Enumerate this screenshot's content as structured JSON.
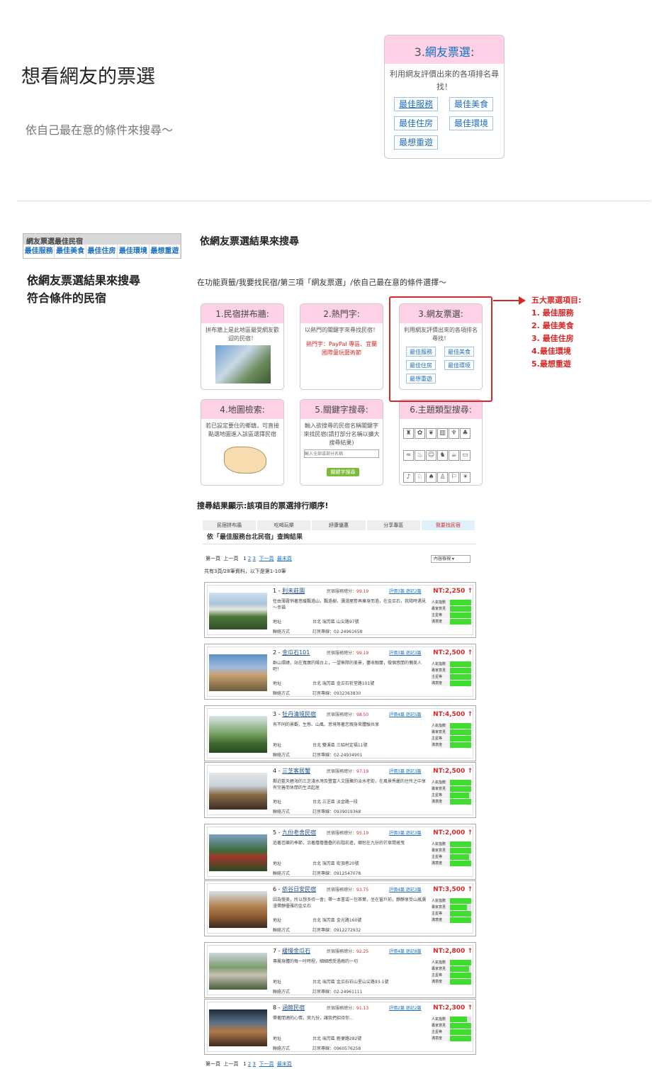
{
  "hero": {
    "title": "想看網友的票選",
    "subtitle": "依自己最在意的條件來搜尋～"
  },
  "big_card": {
    "num": "3.",
    "name": "網友票選",
    "colon": ":",
    "desc": "利用網友評價出來的各項排名尋找！",
    "buttons": [
      "最佳服務",
      "最佳美食",
      "最佳住房",
      "最佳環境",
      "最想重遊"
    ]
  },
  "mini_widget": {
    "title": "網友票選最佳民宿",
    "tabs": [
      "最佳服務",
      "最佳美食",
      "最佳住房",
      "最佳環境",
      "最想重遊"
    ]
  },
  "left_desc": {
    "line1": "依網友票選結果來搜尋",
    "line2": "符合條件的民宿"
  },
  "right_heading": "依網友票選結果來搜尋",
  "path_text": "在功能頁籤/我要找民宿/第三項「網友票選」/依自己最在意的條件選擇～",
  "search_cards": [
    {
      "head": "1.民宿拼布牆:",
      "desc": "拼布牆上是此地區最受網友歡迎的民宿！"
    },
    {
      "head": "2.熱門字:",
      "desc": "以熱門的關鍵字來尋找民宿！",
      "hot": "熱門字：PayPal 專區、宜蘭國際童玩藝術節"
    },
    {
      "head": "3.網友票選:",
      "desc": "利用網友評價出來的各項排名尋找！",
      "buttons": [
        "最佳服務",
        "最佳美食",
        "最佳住房",
        "最佳環境",
        "最想重遊"
      ]
    },
    {
      "head": "4.地圖檢索:",
      "desc": "若已設定要住的鄉鎮，可直接點選地圖進入該區選擇民宿"
    },
    {
      "head": "5.關鍵字搜尋:",
      "desc": "輸入欲搜尋的民宿名稱關鍵字來找民宿(請打部分名稱以擴大搜尋結果)",
      "placeholder": "輸入全部或部分名稱",
      "button": "關鍵字搜尋"
    },
    {
      "head": "6.主題類型搜尋:",
      "desc": ""
    }
  ],
  "red_list": {
    "title": "五大票選項目:",
    "items": [
      "1. 最佳服務",
      "2. 最佳美食",
      "3. 最佳住房",
      "4.最佳環境",
      "5.最想重遊"
    ]
  },
  "result_caption": "搜尋結果顯示:該項目的票選排行順序!",
  "results": {
    "tabs": [
      "民宿拼布牆",
      "吃喝玩樂",
      "紓康優惠",
      "分享專區",
      "我要找民宿"
    ],
    "header": "依「最佳服務台北民宿」查詢結果",
    "pager": {
      "first": "第一頁",
      "prev": "上一頁",
      "pages": [
        "1",
        "2",
        "3"
      ],
      "next": "下一頁",
      "last": "最末頁"
    },
    "sort": "內容檢視",
    "count": "共有3頁/28筆資料，以下是第1-10筆",
    "addr_label": "地址",
    "tel_label": "聯絡方式",
    "score_label": "民宿服務總分：",
    "meter_labels": [
      "人氣指數",
      "專家意見",
      "主星等",
      "滿意度"
    ],
    "items": [
      {
        "rank": "1 -",
        "name": "利未莊園",
        "score": "99.19",
        "links": "評價3篇 遊記2篇",
        "price": "NT:2,250 ↑",
        "desc": "任由薄霧悄著悠緩飄過山，飄過樹，瀰漫屋簷再擁身而過，在金瓜石，我隨時遇見～幸福",
        "addr": "台北 瑞芳區 山尖路97號",
        "tel": "訂房專線：02-24961658",
        "meters": [
          1,
          1,
          1,
          1
        ]
      },
      {
        "rank": "2 -",
        "name": "金瓜石101",
        "score": "99.19",
        "links": "評價3篇 遊記3篇",
        "price": "NT:2,500 ↑",
        "desc": "群山環繞，站在寬廣的陽台上，一望無際的美景，盡收眼簾，做個悠閒的懶美人吧！",
        "addr": "台北 瑞芳區 金瓜石祈堂路101號",
        "tel": "訂房專線：0932363830",
        "meters": [
          1,
          1,
          1,
          1
        ]
      },
      {
        "rank": "3 -",
        "name": "牡丹清境民宿",
        "score": "98.50",
        "links": "評價4篇 遊記5篇",
        "price": "NT:4,500 ↑",
        "desc": "有不同的景觀，生態、山風、意境等著您親身來體驗共享",
        "addr": "台北 雙溪區 三貂村定福11號",
        "tel": "訂房專線：02-24934901",
        "meters": [
          1,
          1,
          1,
          1
        ]
      },
      {
        "rank": "4 -",
        "name": "三芝客居蟹",
        "score": "97.19",
        "links": "評價3篇 遊記3篇",
        "price": "NT:2,500 ↑",
        "desc": "鄰近藍天碧海的三芝淺水灣及豐富人文匯聚的淡水老街，在風景秀麗的住所之中享有完善而休閒的生活起居",
        "addr": "台北 三芝區 淡金路一段",
        "tel": "訂房專線：0939019368",
        "meters": [
          1,
          1,
          0.9,
          1
        ]
      },
      {
        "rank": "5 -",
        "name": "九份老舍民宿",
        "score": "95.19",
        "links": "評價3篇 遊記3篇",
        "price": "NT:2,000 ↑",
        "desc": "追著芭樂的季節，沿著層層疊疊的石階前進，鄉愁在九份的芒草間搖曳",
        "addr": "台北 瑞芳區 街頂巷20號",
        "tel": "訂房專線：0912547078",
        "meters": [
          1,
          1,
          0.9,
          1
        ]
      },
      {
        "rank": "6 -",
        "name": "依谷日安民宿",
        "score": "93.75",
        "links": "評價4篇 遊記3篇",
        "price": "NT:3,500 ↑",
        "desc": "因為慢美，所以想多待一會；帶一本書或一包茶葉，坐在窗戶前，靜靜享受山嵐瀰漫帶靜優雅的金瓜石",
        "addr": "台北 瑞芳區 金光路160號",
        "tel": "訂房專線：0912272932",
        "meters": [
          1,
          0.8,
          1,
          1
        ]
      },
      {
        "rank": "7 -",
        "name": "緩慢金瓜石",
        "score": "92.25",
        "links": "評價4篇 遊記8篇",
        "price": "NT:2,800 ↑",
        "desc": "專屬身體的每一吋時程，細細感受過癮的一切",
        "addr": "台北 瑞芳區 金瓜石石山里山尖路93-1號",
        "tel": "訂房專線：02-24961111",
        "meters": [
          1,
          0.9,
          1,
          1
        ]
      },
      {
        "rank": "8 -",
        "name": "涵館民宿",
        "score": "91.13",
        "links": "評價2篇 遊記2篇",
        "price": "NT:2,300 ↑",
        "desc": "帶著閒適的心情，來九份，讓我們招待你...",
        "addr": "台北 瑞芳區 輕便路282號",
        "tel": "訂房專線：0960576258",
        "meters": [
          0.8,
          1,
          1,
          1
        ]
      }
    ]
  }
}
